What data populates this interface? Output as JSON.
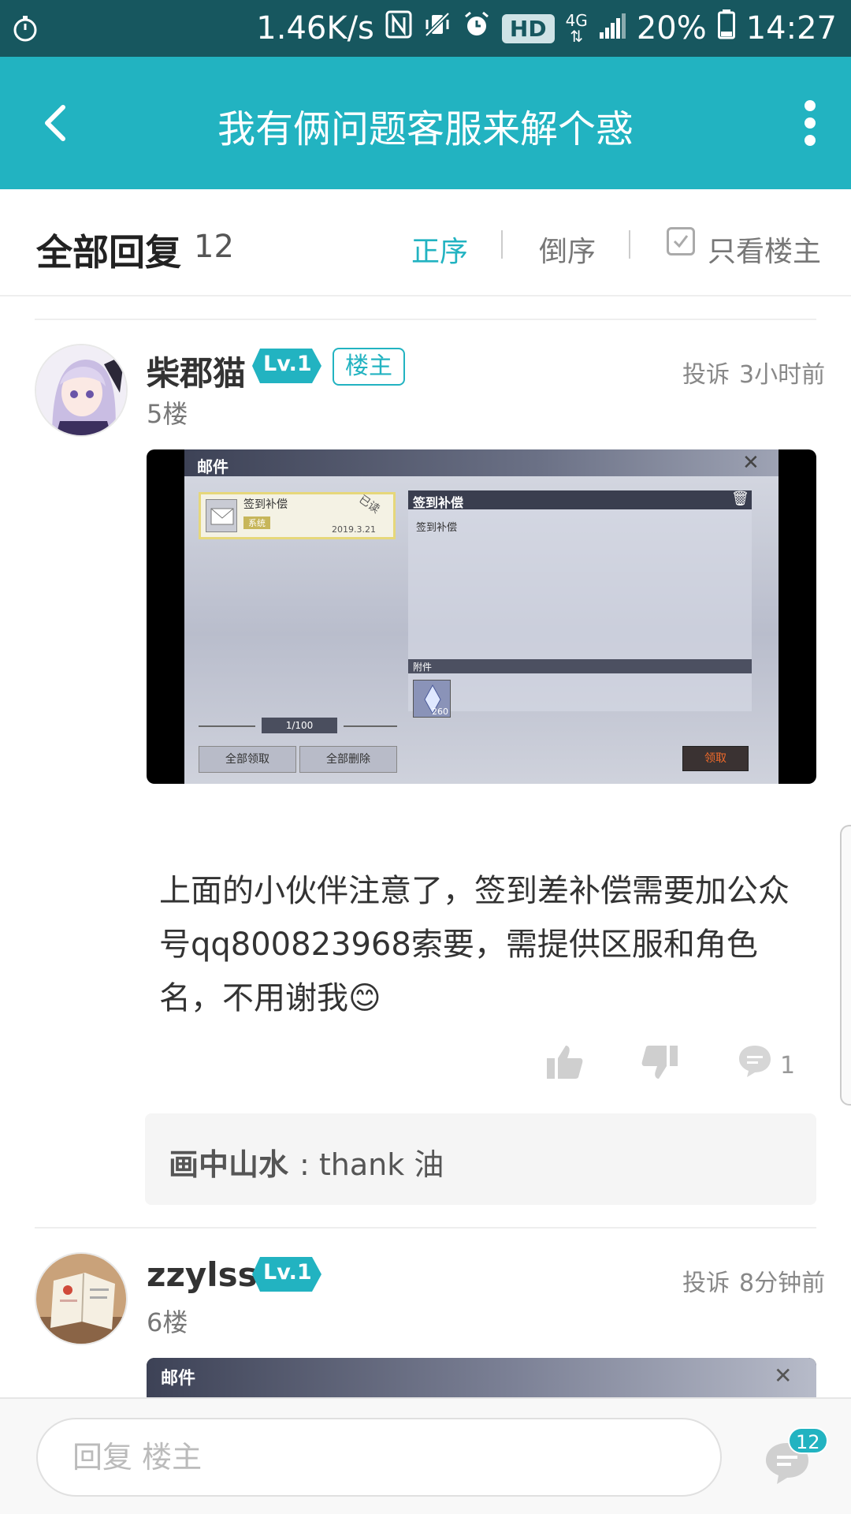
{
  "status_bar": {
    "net_speed": "1.46K/s",
    "hd_label": "HD",
    "network": "4G",
    "battery": "20%",
    "time": "14:27"
  },
  "app_bar": {
    "title": "我有俩问题客服来解个惑"
  },
  "replies_header": {
    "title": "全部回复",
    "count": "12",
    "sort_asc": "正序",
    "sort_desc": "倒序",
    "only_op": "只看楼主"
  },
  "posts": [
    {
      "username": "柴郡猫",
      "level": "Lv.1",
      "op_badge": "楼主",
      "report": "投诉",
      "time": "3小时前",
      "floor": "5楼",
      "screenshot": {
        "panel_title": "邮件",
        "mail_subject": "签到补偿",
        "mail_status": "已读",
        "mail_tag": "系统",
        "mail_date": "2019.3.21",
        "detail_title": "签到补偿",
        "detail_body": "签到补偿",
        "attachment_label": "附件",
        "attachment_count": "260",
        "pager": "1/100",
        "btn_claim_all": "全部领取",
        "btn_delete_all": "全部删除",
        "btn_claim": "领取"
      },
      "text": "上面的小伙伴注意了，签到差补偿需要加公众号qq800823968索要，需提供区服和角色名，不用谢我😊",
      "comment_count": "1",
      "sub_reply": {
        "author": "画中山水",
        "text": ": thank 油"
      }
    },
    {
      "username": "zzylss",
      "level": "Lv.1",
      "report": "投诉",
      "time": "8分钟前",
      "floor": "6楼",
      "screenshot": {
        "panel_title": "邮件"
      }
    }
  ],
  "bottom_bar": {
    "reply_placeholder": "回复  楼主",
    "badge_count": "12"
  },
  "colors": {
    "status_bar": "#17575f",
    "accent": "#22b3c1"
  }
}
